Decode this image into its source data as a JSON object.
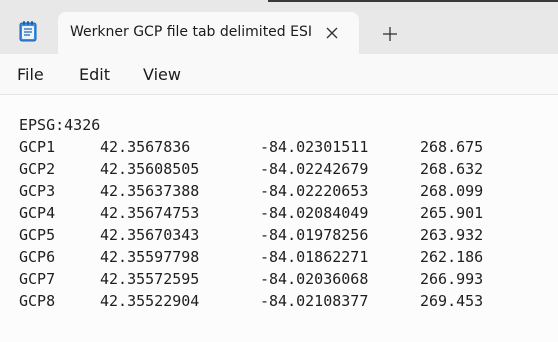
{
  "window": {
    "tab_title": "Werkner GCP file tab delimited ESI",
    "icons": {
      "app": "notepad-icon",
      "close": "close-icon",
      "new_tab": "plus-icon"
    }
  },
  "menu": {
    "items": [
      "File",
      "Edit",
      "View"
    ]
  },
  "document": {
    "header": "EPSG:4326",
    "rows": [
      {
        "id": "GCP1",
        "lat": "42.3567836",
        "lon": "-84.02301511",
        "alt": "268.675"
      },
      {
        "id": "GCP2",
        "lat": "42.35608505",
        "lon": "-84.02242679",
        "alt": "268.632"
      },
      {
        "id": "GCP3",
        "lat": "42.35637388",
        "lon": "-84.02220653",
        "alt": "268.099"
      },
      {
        "id": "GCP4",
        "lat": "42.35674753",
        "lon": "-84.02084049",
        "alt": "265.901"
      },
      {
        "id": "GCP5",
        "lat": "42.35670343",
        "lon": "-84.01978256",
        "alt": "263.932"
      },
      {
        "id": "GCP6",
        "lat": "42.35597798",
        "lon": "-84.01862271",
        "alt": "262.186"
      },
      {
        "id": "GCP7",
        "lat": "42.35572595",
        "lon": "-84.02036068",
        "alt": "266.993"
      },
      {
        "id": "GCP8",
        "lat": "42.35522904",
        "lon": "-84.02108377",
        "alt": "269.453"
      }
    ]
  }
}
